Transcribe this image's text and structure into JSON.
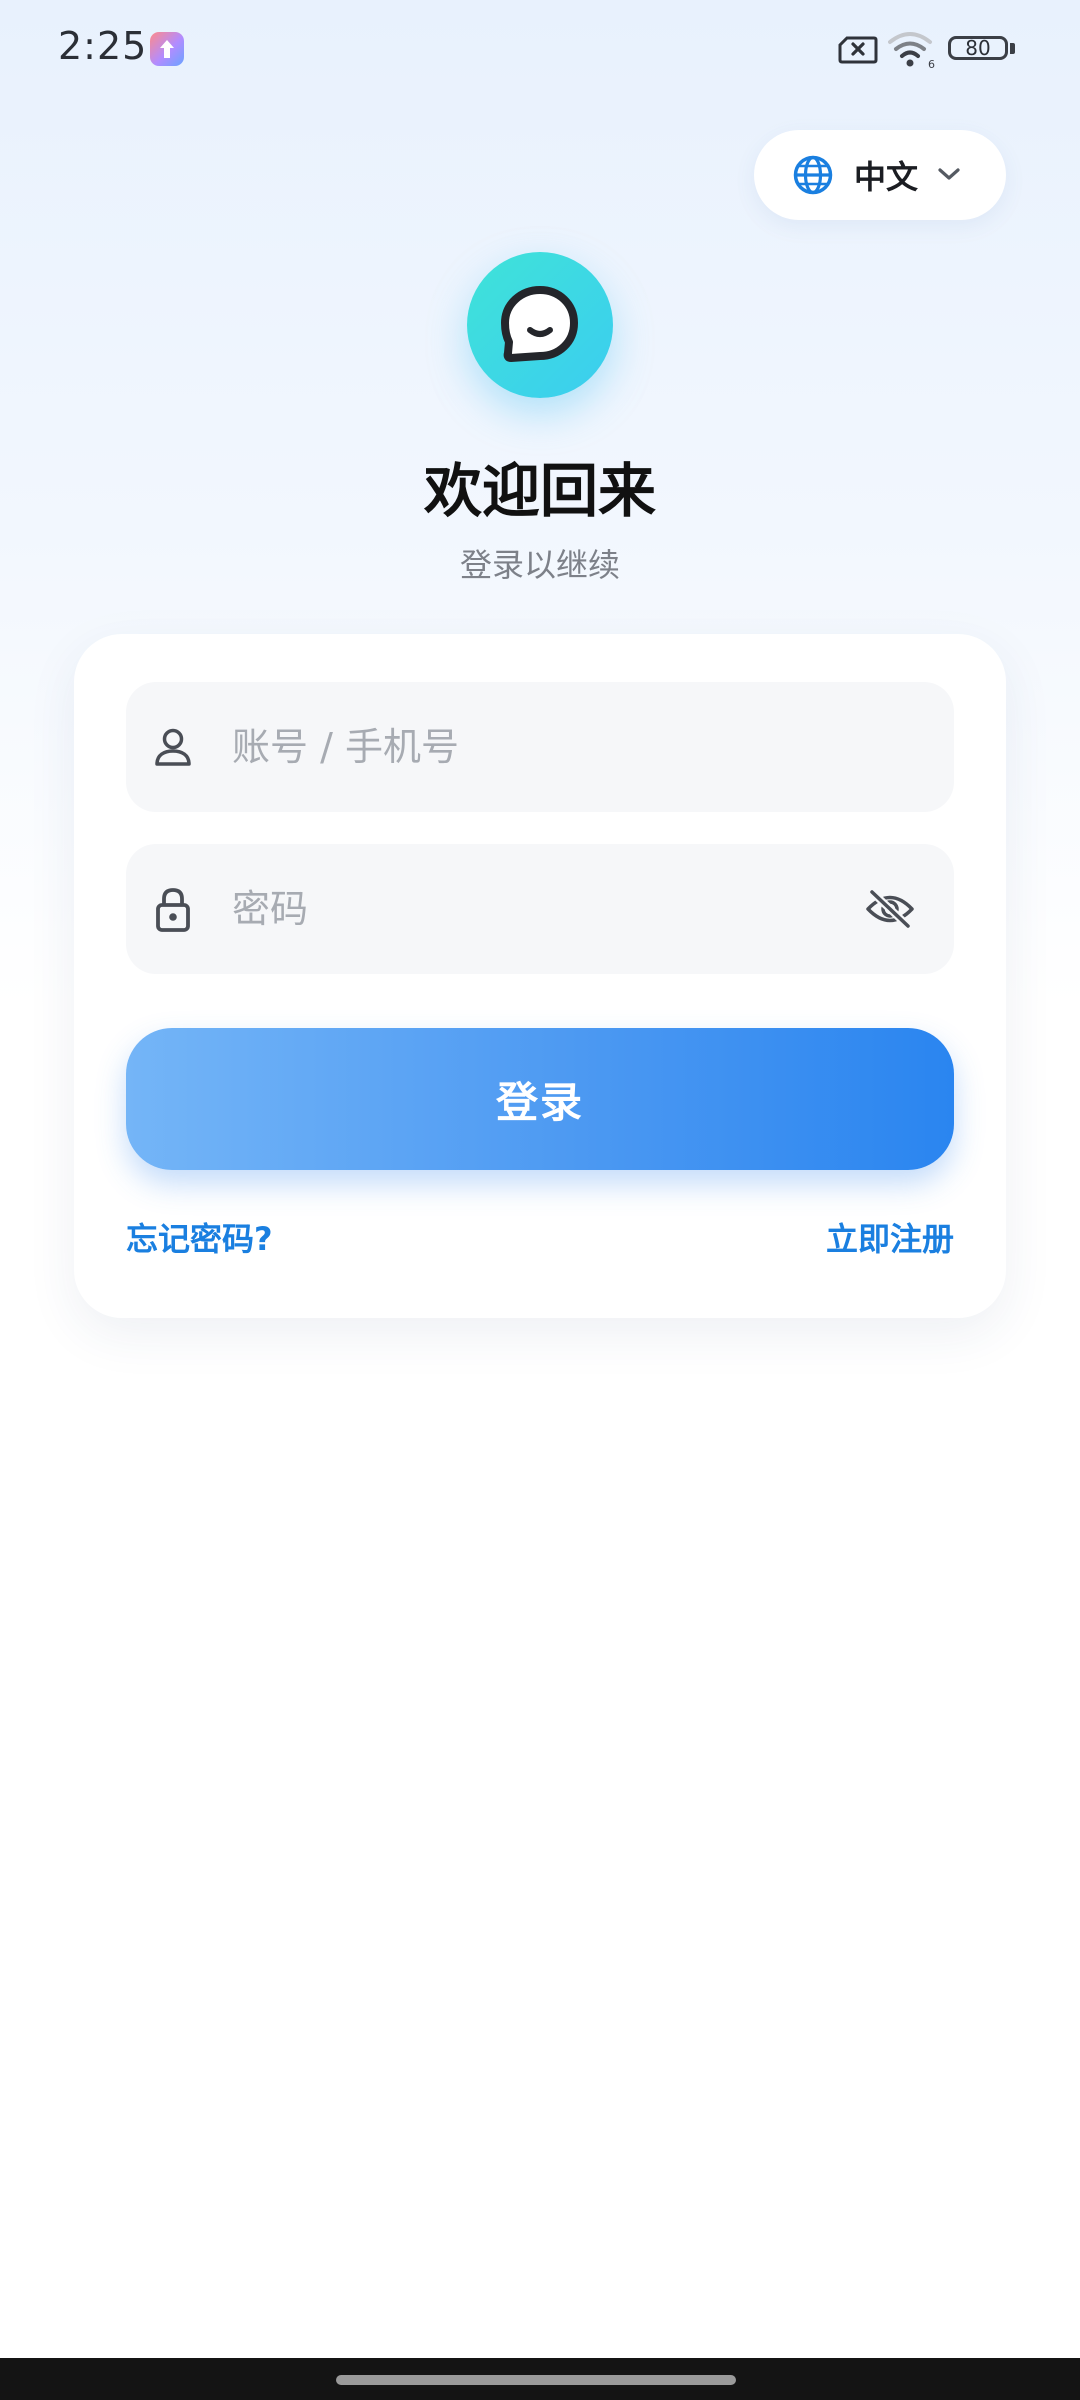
{
  "status_bar": {
    "time": "2:25",
    "battery": "80",
    "icons": [
      "app-notification-icon",
      "sim-no-service-icon",
      "wifi-icon",
      "battery-icon"
    ]
  },
  "language": {
    "label": "中文",
    "icon": "globe-icon"
  },
  "header": {
    "title": "欢迎回来",
    "subtitle": "登录以继续",
    "logo_icon": "chat-bubble-icon"
  },
  "form": {
    "account_placeholder": "账号 / 手机号",
    "password_placeholder": "密码",
    "submit_label": "登录",
    "forgot_label": "忘记密码?",
    "register_label": "立即注册"
  },
  "colors": {
    "accent": "#1a7fe0",
    "button_start": "#74b5f7",
    "button_end": "#2a85f0",
    "logo_start": "#3fe3d8",
    "logo_end": "#3bcdf0"
  }
}
